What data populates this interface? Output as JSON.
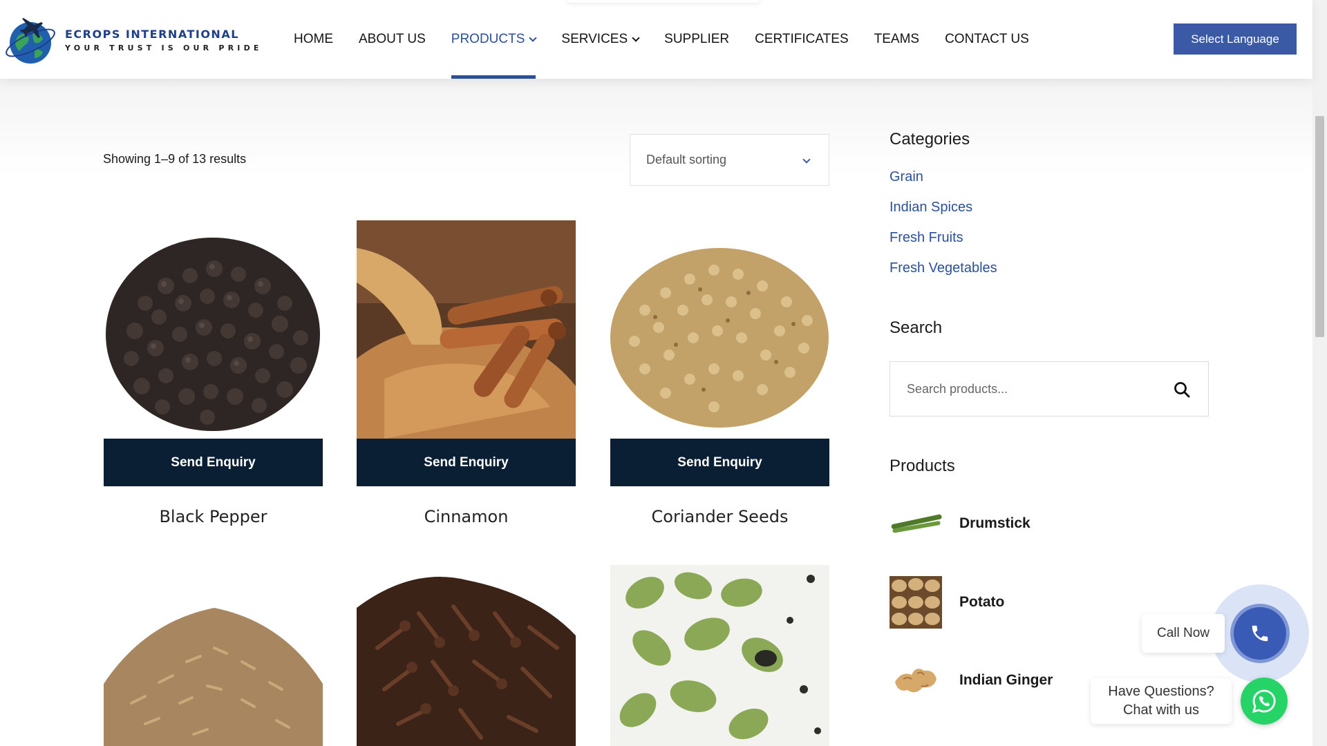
{
  "brand": {
    "name": "ECROPS INTERNATIONAL",
    "tagline": "YOUR TRUST IS OUR PRIDE"
  },
  "nav": {
    "items": [
      {
        "label": "HOME"
      },
      {
        "label": "ABOUT US"
      },
      {
        "label": "PRODUCTS",
        "active": true,
        "has_dropdown": true
      },
      {
        "label": "SERVICES",
        "has_dropdown": true
      },
      {
        "label": "SUPPLIER"
      },
      {
        "label": "CERTIFICATES"
      },
      {
        "label": "TEAMS"
      },
      {
        "label": "CONTACT US"
      }
    ],
    "language_button": "Select Language"
  },
  "shop": {
    "results_text": "Showing 1–9 of 13 results",
    "sort_value": "Default sorting",
    "enquiry_label": "Send Enquiry",
    "products": [
      {
        "name": "Black Pepper"
      },
      {
        "name": "Cinnamon"
      },
      {
        "name": "Coriander Seeds"
      },
      {
        "name": ""
      },
      {
        "name": ""
      },
      {
        "name": ""
      }
    ]
  },
  "sidebar": {
    "categories_heading": "Categories",
    "categories": [
      "Grain",
      "Indian Spices",
      "Fresh Fruits",
      "Fresh Vegetables"
    ],
    "search_heading": "Search",
    "search_placeholder": "Search products...",
    "products_heading": "Products",
    "products": [
      {
        "name": "Drumstick"
      },
      {
        "name": "Potato"
      },
      {
        "name": "Indian Ginger"
      }
    ]
  },
  "widgets": {
    "call_label": "Call Now",
    "chat_line1": "Have Questions?",
    "chat_line2": "Chat with us"
  },
  "colors": {
    "brand_blue": "#2c4f99",
    "button_dark": "#0a1e34",
    "whatsapp_green": "#25d366"
  }
}
